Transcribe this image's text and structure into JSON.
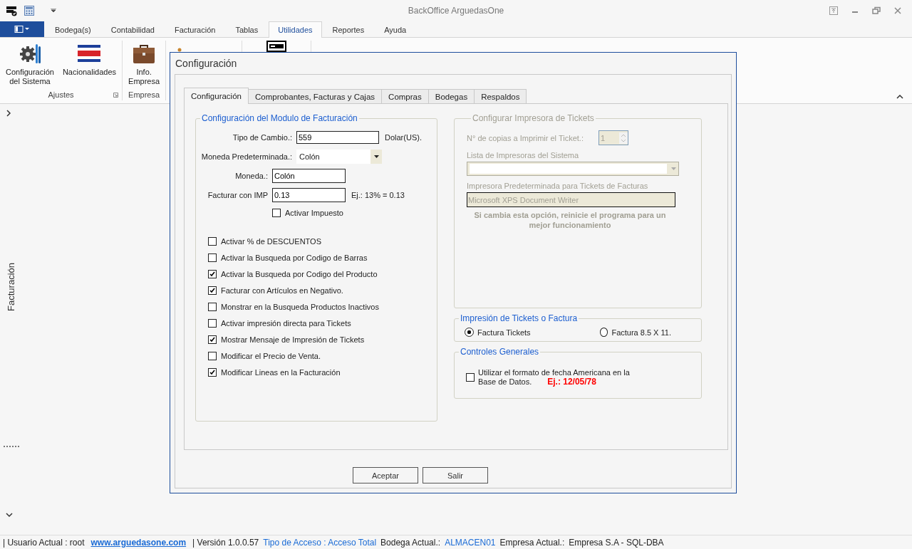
{
  "window": {
    "title": "BackOffice ArguedasOne"
  },
  "menu_tabs": [
    {
      "label": "Bodega(s)",
      "selected": false
    },
    {
      "label": "Contabilidad",
      "selected": false
    },
    {
      "label": "Facturación",
      "selected": false
    },
    {
      "label": "Tablas",
      "selected": false
    },
    {
      "label": "Utilidades",
      "selected": true
    },
    {
      "label": "Reportes",
      "selected": false
    },
    {
      "label": "Ayuda",
      "selected": false
    }
  ],
  "ribbon": {
    "groups": [
      {
        "label": "Ajustes",
        "items": [
          {
            "label": "Configuración\ndel Sistema",
            "kind": "gear"
          },
          {
            "label": "Nacionalidades",
            "kind": "flag"
          }
        ]
      },
      {
        "label": "Empresa",
        "items": [
          {
            "label": "Info.\nEmpresa",
            "kind": "briefcase"
          }
        ]
      }
    ]
  },
  "sidebar": {
    "label": "Facturación"
  },
  "dialog": {
    "title": "Configuración",
    "tabs": [
      {
        "label": "Configuración",
        "selected": true
      },
      {
        "label": "Comprobantes, Facturas y Cajas",
        "selected": false
      },
      {
        "label": "Compras",
        "selected": false
      },
      {
        "label": "Bodegas",
        "selected": false
      },
      {
        "label": "Respaldos",
        "selected": false
      }
    ],
    "module_group": {
      "title": "Configuración del Modulo de Facturación",
      "fields": [
        {
          "label": "Tipo de Cambio.:",
          "value": "559",
          "kind": "input",
          "suffix": "Dolar(US)."
        },
        {
          "label": "Moneda Predeterminada.:",
          "value": "Colón",
          "kind": "select"
        },
        {
          "label": "Moneda.:",
          "value": "Colón",
          "kind": "input"
        },
        {
          "label": "Facturar con IMP",
          "value": "0.13",
          "kind": "input",
          "suffix": "Ej.: 13% = 0.13"
        }
      ],
      "tax_checkbox": {
        "label": "Activar Impuesto",
        "checked": false
      },
      "options": [
        {
          "label": "Activar %  de DESCUENTOS",
          "checked": false
        },
        {
          "label": "Activar la Busqueda por  Codigo de Barras",
          "checked": false
        },
        {
          "label": "Activar la Busqueda por Codigo del Producto",
          "checked": true
        },
        {
          "label": "Facturar con Artículos en Negativo.",
          "checked": true
        },
        {
          "label": "Monstrar en la Busqueda Productos Inactivos",
          "checked": false
        },
        {
          "label": "Activar impresión directa para Tickets",
          "checked": false
        },
        {
          "label": "Mostrar Mensaje de Impresión de Tickets",
          "checked": true
        },
        {
          "label": "Modificar el Precio de Venta.",
          "checked": false
        },
        {
          "label": "Modificar Lineas en la Facturación",
          "checked": true
        }
      ]
    },
    "printer_group": {
      "title": "Configurar Impresora de Tickets",
      "disabled": true,
      "copies_label": "N° de copias a Imprimir el Ticket.:",
      "copies_value": "1",
      "list_label": "Lista de Impresoras del Sistema",
      "default_label": "Impresora Predeterminada para Tickets de Facturas",
      "default_value": "Microsoft XPS Document Writer",
      "warning": "Si cambia esta opción, reinicie el programa para un mejor funcionamiento"
    },
    "print_mode_group": {
      "title": "Impresión de Tickets o Factura",
      "options": [
        {
          "label": "Factura Tickets",
          "selected": true
        },
        {
          "label": "Factura 8.5 X 11.",
          "selected": false
        }
      ]
    },
    "general_group": {
      "title": "Controles Generales",
      "checkbox": {
        "lines": [
          "Utilizar el formato de fecha Americana en la",
          "Base de Datos."
        ],
        "checked": false
      },
      "example": "Ej.: 12/05/78"
    },
    "buttons": [
      "Aceptar",
      "Salir"
    ]
  },
  "status_bar": [
    {
      "text": "| Usuario Actual : root",
      "kind": "text"
    },
    {
      "text": "www.arguedasone.com",
      "kind": "link"
    },
    {
      "text": "| Versión 1.0.0.57",
      "kind": "text"
    },
    {
      "text": "Tipo de Acceso : Acceso Total",
      "kind": "value"
    },
    {
      "text": "Bodega Actual.:",
      "kind": "text"
    },
    {
      "text": "ALMACEN01",
      "kind": "value"
    },
    {
      "text": "Empresa Actual.:",
      "kind": "text"
    },
    {
      "text": "Empresa S.A  - SQL-DBA",
      "kind": "text"
    }
  ]
}
